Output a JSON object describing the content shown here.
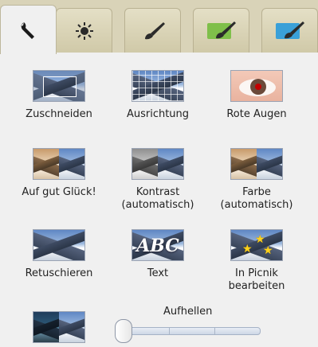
{
  "tabs": [
    {
      "name": "tab-wrench",
      "icon": "wrench-icon",
      "active": true
    },
    {
      "name": "tab-effects",
      "icon": "sun-icon",
      "active": false
    },
    {
      "name": "tab-paint",
      "icon": "brush-icon",
      "active": false
    },
    {
      "name": "tab-paint-green",
      "icon": "brush-icon",
      "active": false
    },
    {
      "name": "tab-paint-blue",
      "icon": "brush-icon",
      "active": false
    }
  ],
  "tools": {
    "crop": {
      "label": "Zuschneiden"
    },
    "straighten": {
      "label": "Ausrichtung"
    },
    "red_eye": {
      "label": "Rote Augen"
    },
    "lucky": {
      "label": "Auf gut Glück!"
    },
    "auto_contrast": {
      "label": "Kontrast\n(automatisch)"
    },
    "auto_color": {
      "label": "Farbe\n(automatisch)"
    },
    "retouch": {
      "label": "Retuschieren"
    },
    "text": {
      "label": "Text",
      "thumb_text": "ABC"
    },
    "picnik": {
      "label": "In Picnik\nbearbeiten"
    }
  },
  "brighten": {
    "label": "Aufhellen",
    "value": 0
  },
  "colors": {
    "tabbar_bg": "#d9d3b8",
    "panel_bg": "#f0f0f0",
    "text": "#222222"
  }
}
